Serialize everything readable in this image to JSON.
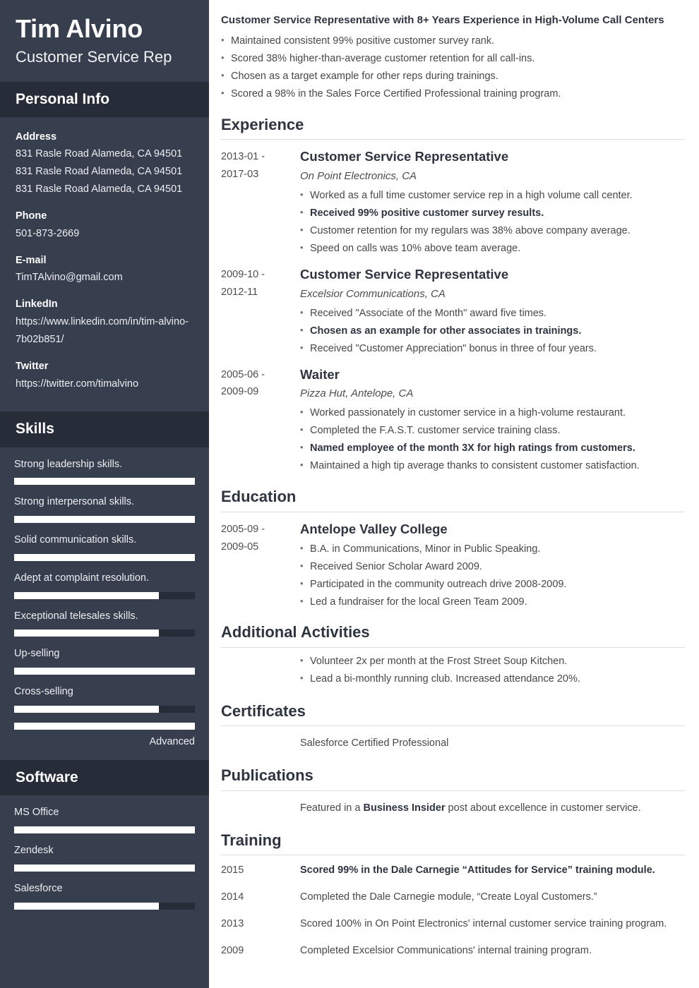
{
  "sidebar": {
    "name": "Tim Alvino",
    "job_title": "Customer Service Rep",
    "personal_info": {
      "heading": "Personal Info",
      "fields": [
        {
          "label": "Address",
          "value": "831 Rasle Road\nAlameda, CA\n94501"
        },
        {
          "label": "Phone",
          "value": "501-873-2669"
        },
        {
          "label": "E-mail",
          "value": "TimTAlvino@gmail.com"
        },
        {
          "label": "LinkedIn",
          "value": "https://www.linkedin.com/in/tim-alvino-7b02b851/"
        },
        {
          "label": "Twitter",
          "value": "https://twitter.com/timalvino"
        }
      ]
    },
    "skills": {
      "heading": "Skills",
      "items": [
        {
          "name": "Strong leadership skills.",
          "percent": 100,
          "level": ""
        },
        {
          "name": "Strong interpersonal skills.",
          "percent": 100,
          "level": ""
        },
        {
          "name": "Solid communication skills.",
          "percent": 100,
          "level": ""
        },
        {
          "name": "Adept at complaint resolution.",
          "percent": 80,
          "level": ""
        },
        {
          "name": "Exceptional telesales skills.",
          "percent": 80,
          "level": ""
        },
        {
          "name": "Up-selling",
          "percent": 100,
          "level": ""
        },
        {
          "name": "Cross-selling",
          "percent": 80,
          "level": ""
        },
        {
          "name": "",
          "percent": 100,
          "level": "Advanced"
        }
      ]
    },
    "software": {
      "heading": "Software",
      "items": [
        {
          "name": "MS Office",
          "percent": 100,
          "level": ""
        },
        {
          "name": "Zendesk",
          "percent": 100,
          "level": ""
        },
        {
          "name": "Salesforce",
          "percent": 80,
          "level": ""
        }
      ]
    }
  },
  "main": {
    "summary": {
      "title": "Customer Service Representative with 8+ Years Experience in High-Volume Call Centers",
      "bullets": [
        "Maintained consistent 99% positive customer survey rank.",
        "Scored 38% higher-than-average customer retention for all call-ins.",
        "Chosen as a target example for other reps during trainings.",
        "Scored a 98% in the Sales Force Certified Professional training program."
      ]
    },
    "experience": {
      "heading": "Experience",
      "entries": [
        {
          "dates": "2013-01 - 2017-03",
          "role": "Customer Service Representative",
          "org": "On Point Electronics, CA",
          "bullets": [
            {
              "text": "Worked as a full time customer service rep in a high volume call center.",
              "bold": false
            },
            {
              "text": "Received 99% positive customer survey results.",
              "bold": true
            },
            {
              "text": "Customer retention for my regulars was 38% above company average.",
              "bold": false
            },
            {
              "text": "Speed on calls was 10% above team average.",
              "bold": false
            }
          ]
        },
        {
          "dates": "2009-10 - 2012-11",
          "role": "Customer Service Representative",
          "org": "Excelsior Communications, CA",
          "bullets": [
            {
              "text": "Received \"Associate of the Month\" award five times.",
              "bold": false
            },
            {
              "text": "Chosen as an example for other associates in trainings.",
              "bold": true
            },
            {
              "text": "Received \"Customer Appreciation\" bonus in three of four years.",
              "bold": false
            }
          ]
        },
        {
          "dates": "2005-06 - 2009-09",
          "role": "Waiter",
          "org": "Pizza Hut, Antelope, CA",
          "bullets": [
            {
              "text": "Worked passionately in customer service in a high-volume restaurant.",
              "bold": false
            },
            {
              "text": "Completed the F.A.S.T. customer service training class.",
              "bold": false
            },
            {
              "text": "Named employee of the month 3X for high ratings from customers.",
              "bold": true
            },
            {
              "text": "Maintained a high tip average thanks to consistent customer satisfaction.",
              "bold": false
            }
          ]
        }
      ]
    },
    "education": {
      "heading": "Education",
      "entries": [
        {
          "dates": "2005-09 - 2009-05",
          "school": "Antelope Valley College",
          "bullets": [
            "B.A. in Communications, Minor in Public Speaking.",
            "Received Senior Scholar Award 2009.",
            "Participated in the community outreach drive 2008-2009.",
            "Led a fundraiser for the local Green Team 2009."
          ]
        }
      ]
    },
    "additional_activities": {
      "heading": "Additional Activities",
      "bullets": [
        "Volunteer 2x per month at the Frost Street Soup Kitchen.",
        "Lead a bi-monthly running club. Increased attendance 20%."
      ]
    },
    "certificates": {
      "heading": "Certificates",
      "items": [
        "Salesforce Certified Professional"
      ]
    },
    "publications": {
      "heading": "Publications",
      "items": [
        {
          "prefix": "Featured in a ",
          "bold": "Business Insider",
          "suffix": " post about excellence in customer service."
        }
      ]
    },
    "training": {
      "heading": "Training",
      "entries": [
        {
          "year": "2015",
          "text": "Scored 99% in the Dale Carnegie “Attitudes for Service” training module.",
          "bold": true
        },
        {
          "year": "2014",
          "text": "Completed the Dale Carnegie module, “Create Loyal Customers.”",
          "bold": false
        },
        {
          "year": "2013",
          "text": "Scored 100% in On Point Electronics' internal customer service training program.",
          "bold": false
        },
        {
          "year": "2009",
          "text": "Completed Excelsior Communications' internal training program.",
          "bold": false
        }
      ]
    }
  },
  "theme": {
    "sidebar_bg": "#373f4f",
    "sidebar_header_bg": "#262c38",
    "bar_fill": "#ffffff",
    "bar_track": "#262c38",
    "text_dark": "#2f3540",
    "rule": "#dadde1"
  }
}
